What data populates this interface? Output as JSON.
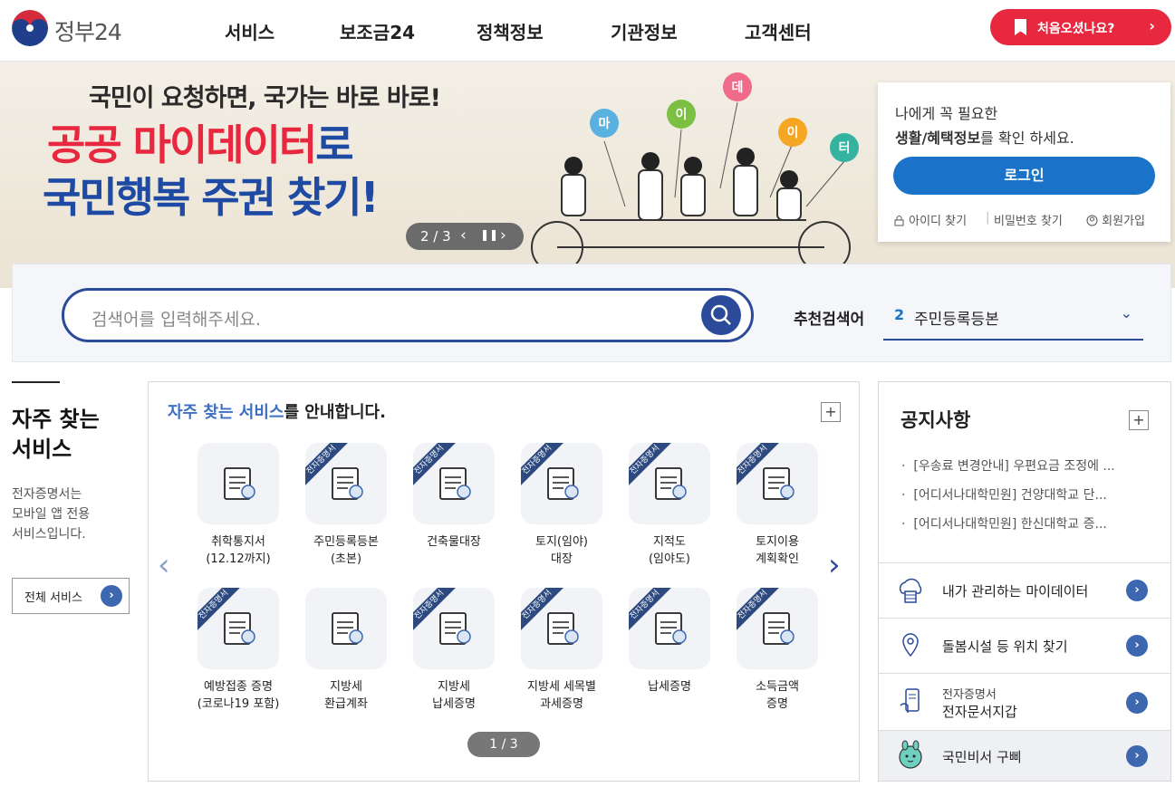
{
  "header": {
    "logo_text": "정부24",
    "nav": [
      "서비스",
      "보조금24",
      "정책정보",
      "기관정보",
      "고객센터"
    ],
    "first_visit_label": "처음오셨나요?"
  },
  "banner": {
    "line1": "국민이 요청하면, 국가는 바로 바로!",
    "line2_a": "공공 ",
    "line2_b": "마이데이터",
    "line2_c": "로",
    "line3": "국민행복 주권 찾기!",
    "balloons": [
      "마",
      "이",
      "데",
      "이",
      "터"
    ],
    "slide_indicator": "2 / 3"
  },
  "login": {
    "line1": "나에게 꼭 필요한",
    "line2_bold": "생활/혜택정보",
    "line2_rest": "를 확인 하세요.",
    "button": "로그인",
    "links": [
      "아이디 찾기",
      "비밀번호 찾기",
      "회원가입"
    ]
  },
  "search": {
    "placeholder": "검색어를 입력해주세요.",
    "recommend_label": "추천검색어",
    "recommend_num": "2",
    "recommend_text": "주민등록등본"
  },
  "side": {
    "title_1": "자주 찾는",
    "title_2": "서비스",
    "desc_1": "전자증명서는",
    "desc_2": "모바일 앱 전용",
    "desc_3": "서비스입니다.",
    "all_button": "전체 서비스"
  },
  "services": {
    "heading_highlight": "자주 찾는 서비스",
    "heading_rest": "를 안내합니다.",
    "ribbon": "전자증명서",
    "items": [
      {
        "line1": "취학통지서",
        "line2": "(12.12까지)",
        "ribbon": false
      },
      {
        "line1": "주민등록등본",
        "line2": "(초본)",
        "ribbon": true
      },
      {
        "line1": "건축물대장",
        "line2": "",
        "ribbon": true
      },
      {
        "line1": "토지(임야)",
        "line2": "대장",
        "ribbon": true
      },
      {
        "line1": "지적도",
        "line2": "(임야도)",
        "ribbon": true
      },
      {
        "line1": "토지이용",
        "line2": "계획확인",
        "ribbon": true
      },
      {
        "line1": "예방접종 증명",
        "line2": "(코로나19 포함)",
        "ribbon": true
      },
      {
        "line1": "지방세",
        "line2": "환급계좌",
        "ribbon": false
      },
      {
        "line1": "지방세",
        "line2": "납세증명",
        "ribbon": true
      },
      {
        "line1": "지방세 세목별",
        "line2": "과세증명",
        "ribbon": true
      },
      {
        "line1": "납세증명",
        "line2": "",
        "ribbon": true
      },
      {
        "line1": "소득금액",
        "line2": "증명",
        "ribbon": true
      }
    ],
    "pager": "1 / 3"
  },
  "notice": {
    "title": "공지사항",
    "items": [
      "[우송료 변경안내] 우편요금 조정에 ...",
      "[어디서나대학민원] 건양대학교 단...",
      "[어디서나대학민원] 한신대학교 증..."
    ]
  },
  "quick": {
    "mydata": "내가 관리하는 마이데이터",
    "care": "돌봄시설 등 위치 찾기",
    "wallet_sub": "전자증명서",
    "wallet": "전자문서지갑",
    "gubbi": "국민비서 구삐"
  },
  "colors": {
    "brand_blue": "#2b4a9a",
    "accent_red": "#e8283f",
    "login_blue": "#1a73c8"
  }
}
